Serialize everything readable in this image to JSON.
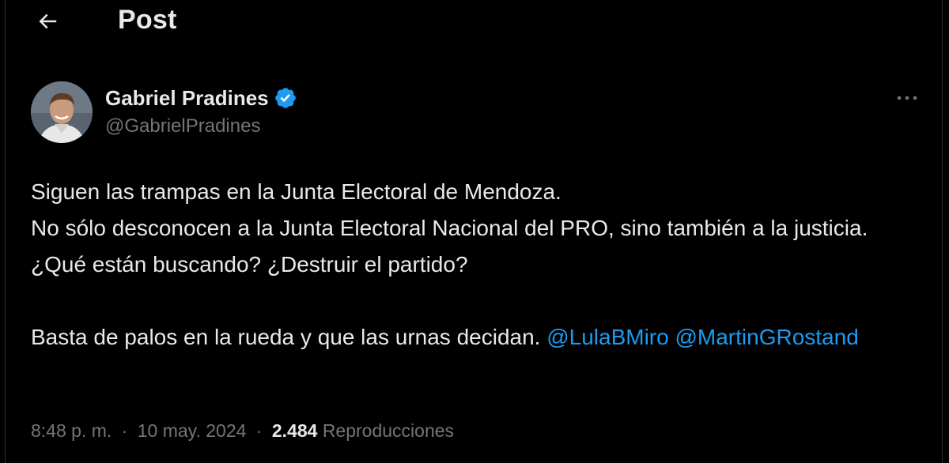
{
  "header": {
    "title": "Post"
  },
  "author": {
    "name": "Gabriel Pradines",
    "handle": "@GabrielPradines",
    "verified": true
  },
  "tweet": {
    "line1": "Siguen las trampas en la Junta Electoral de Mendoza.",
    "line2": "No sólo desconocen a la Junta Electoral Nacional del PRO, sino también a la justicia. ¿Qué están buscando? ¿Destruir el partido?",
    "line3": "Basta de palos en la rueda y que las urnas decidan.",
    "mention1": "@LulaBMiro",
    "mention2": "@MartinGRostand"
  },
  "meta": {
    "time": "8:48 p. m.",
    "separator": "·",
    "date": "10 may. 2024",
    "views_count": "2.484",
    "views_label": "Reproducciones"
  },
  "icons": {
    "back": "arrow-left-icon",
    "verified": "verified-badge-icon",
    "more": "more-horizontal-icon"
  },
  "colors": {
    "background": "#000000",
    "text": "#e7e9ea",
    "secondary": "#71767b",
    "accent": "#1d9bf0"
  }
}
